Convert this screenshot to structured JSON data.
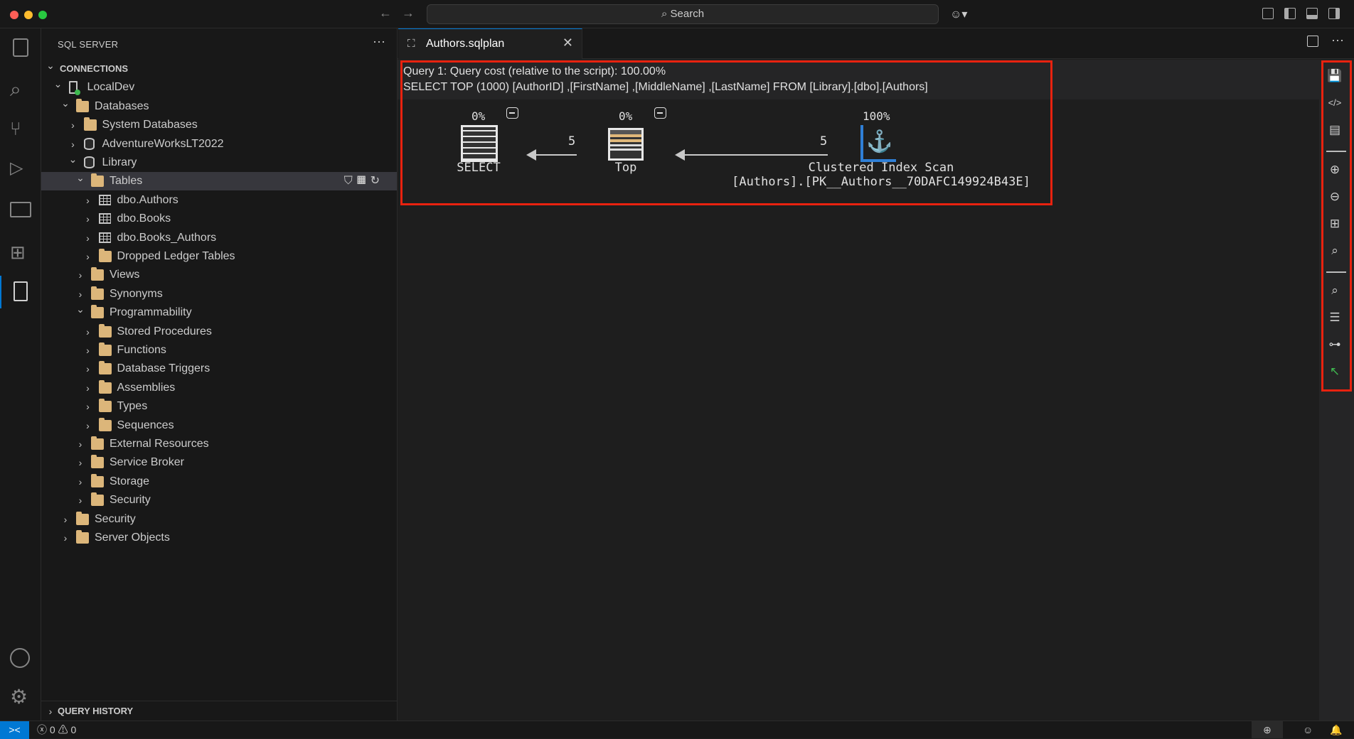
{
  "titlebar": {
    "search_label": "Search",
    "search_icon": "magnifier-icon"
  },
  "sidebar": {
    "title": "SQL SERVER",
    "more_label": "···",
    "tree": [
      {
        "level": 0,
        "expanded": true,
        "icon": "none",
        "label": "CONNECTIONS",
        "header": true
      },
      {
        "level": 1,
        "expanded": true,
        "icon": "server",
        "label": "LocalDev"
      },
      {
        "level": 2,
        "expanded": true,
        "icon": "folder",
        "label": "Databases"
      },
      {
        "level": 3,
        "expanded": false,
        "icon": "folder",
        "label": "System Databases"
      },
      {
        "level": 3,
        "expanded": false,
        "icon": "database",
        "label": "AdventureWorksLT2022"
      },
      {
        "level": 3,
        "expanded": true,
        "icon": "database",
        "label": "Library"
      },
      {
        "level": 4,
        "expanded": true,
        "icon": "folder",
        "label": "Tables",
        "selected": true
      },
      {
        "level": 5,
        "expanded": false,
        "icon": "table",
        "label": "dbo.Authors"
      },
      {
        "level": 5,
        "expanded": false,
        "icon": "table",
        "label": "dbo.Books"
      },
      {
        "level": 5,
        "expanded": false,
        "icon": "table",
        "label": "dbo.Books_Authors"
      },
      {
        "level": 5,
        "expanded": false,
        "icon": "folder",
        "label": "Dropped Ledger Tables"
      },
      {
        "level": 4,
        "expanded": false,
        "icon": "folder",
        "label": "Views"
      },
      {
        "level": 4,
        "expanded": false,
        "icon": "folder",
        "label": "Synonyms"
      },
      {
        "level": 4,
        "expanded": true,
        "icon": "folder",
        "label": "Programmability"
      },
      {
        "level": 5,
        "expanded": false,
        "icon": "folder",
        "label": "Stored Procedures"
      },
      {
        "level": 5,
        "expanded": false,
        "icon": "folder",
        "label": "Functions"
      },
      {
        "level": 5,
        "expanded": false,
        "icon": "folder",
        "label": "Database Triggers"
      },
      {
        "level": 5,
        "expanded": false,
        "icon": "folder",
        "label": "Assemblies"
      },
      {
        "level": 5,
        "expanded": false,
        "icon": "folder",
        "label": "Types"
      },
      {
        "level": 5,
        "expanded": false,
        "icon": "folder",
        "label": "Sequences"
      },
      {
        "level": 4,
        "expanded": false,
        "icon": "folder",
        "label": "External Resources"
      },
      {
        "level": 4,
        "expanded": false,
        "icon": "folder",
        "label": "Service Broker"
      },
      {
        "level": 4,
        "expanded": false,
        "icon": "folder",
        "label": "Storage"
      },
      {
        "level": 4,
        "expanded": false,
        "icon": "folder",
        "label": "Security"
      },
      {
        "level": 2,
        "expanded": false,
        "icon": "folder",
        "label": "Security"
      },
      {
        "level": 2,
        "expanded": false,
        "icon": "folder",
        "label": "Server Objects"
      }
    ],
    "query_history": "QUERY HISTORY"
  },
  "editor": {
    "tab_label": "Authors.sqlplan",
    "query_cost": "Query 1: Query cost (relative to the script): 100.00%",
    "query_text": "SELECT TOP (1000) [AuthorID] ,[FirstName] ,[MiddleName] ,[LastName] FROM [Library].[dbo].[Authors]",
    "nodes": [
      {
        "name": "SELECT",
        "cost": "0%",
        "detail": ""
      },
      {
        "name": "Top",
        "cost": "0%",
        "detail": ""
      },
      {
        "name": "Clustered Index Scan",
        "cost": "100%",
        "detail": "[Authors].[PK__Authors__70DAFC149924B43E]"
      }
    ],
    "edges": [
      {
        "rows": "5"
      },
      {
        "rows": "5"
      }
    ]
  },
  "toolbar": [
    "save-plan",
    "open-query",
    "open-xml",
    "zoom-in",
    "zoom-out",
    "zoom-custom",
    "zoom-to-fit",
    "find-node",
    "properties",
    "compare-plans",
    "highlight-expensive"
  ],
  "status": {
    "errors": "0",
    "warnings": "0"
  },
  "colors": {
    "accent": "#0078d4",
    "highlight_box": "#e8220f",
    "folder": "#dcb67a",
    "connected": "#3fb950"
  }
}
